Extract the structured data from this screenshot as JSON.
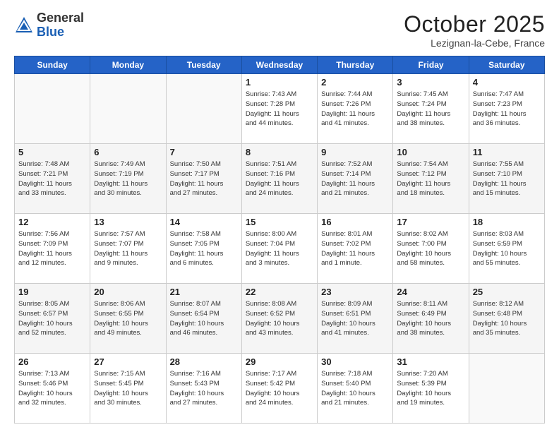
{
  "logo": {
    "general": "General",
    "blue": "Blue"
  },
  "header": {
    "month": "October 2025",
    "location": "Lezignan-la-Cebe, France"
  },
  "days_of_week": [
    "Sunday",
    "Monday",
    "Tuesday",
    "Wednesday",
    "Thursday",
    "Friday",
    "Saturday"
  ],
  "weeks": [
    [
      {
        "day": "",
        "info": ""
      },
      {
        "day": "",
        "info": ""
      },
      {
        "day": "",
        "info": ""
      },
      {
        "day": "1",
        "info": "Sunrise: 7:43 AM\nSunset: 7:28 PM\nDaylight: 11 hours\nand 44 minutes."
      },
      {
        "day": "2",
        "info": "Sunrise: 7:44 AM\nSunset: 7:26 PM\nDaylight: 11 hours\nand 41 minutes."
      },
      {
        "day": "3",
        "info": "Sunrise: 7:45 AM\nSunset: 7:24 PM\nDaylight: 11 hours\nand 38 minutes."
      },
      {
        "day": "4",
        "info": "Sunrise: 7:47 AM\nSunset: 7:23 PM\nDaylight: 11 hours\nand 36 minutes."
      }
    ],
    [
      {
        "day": "5",
        "info": "Sunrise: 7:48 AM\nSunset: 7:21 PM\nDaylight: 11 hours\nand 33 minutes."
      },
      {
        "day": "6",
        "info": "Sunrise: 7:49 AM\nSunset: 7:19 PM\nDaylight: 11 hours\nand 30 minutes."
      },
      {
        "day": "7",
        "info": "Sunrise: 7:50 AM\nSunset: 7:17 PM\nDaylight: 11 hours\nand 27 minutes."
      },
      {
        "day": "8",
        "info": "Sunrise: 7:51 AM\nSunset: 7:16 PM\nDaylight: 11 hours\nand 24 minutes."
      },
      {
        "day": "9",
        "info": "Sunrise: 7:52 AM\nSunset: 7:14 PM\nDaylight: 11 hours\nand 21 minutes."
      },
      {
        "day": "10",
        "info": "Sunrise: 7:54 AM\nSunset: 7:12 PM\nDaylight: 11 hours\nand 18 minutes."
      },
      {
        "day": "11",
        "info": "Sunrise: 7:55 AM\nSunset: 7:10 PM\nDaylight: 11 hours\nand 15 minutes."
      }
    ],
    [
      {
        "day": "12",
        "info": "Sunrise: 7:56 AM\nSunset: 7:09 PM\nDaylight: 11 hours\nand 12 minutes."
      },
      {
        "day": "13",
        "info": "Sunrise: 7:57 AM\nSunset: 7:07 PM\nDaylight: 11 hours\nand 9 minutes."
      },
      {
        "day": "14",
        "info": "Sunrise: 7:58 AM\nSunset: 7:05 PM\nDaylight: 11 hours\nand 6 minutes."
      },
      {
        "day": "15",
        "info": "Sunrise: 8:00 AM\nSunset: 7:04 PM\nDaylight: 11 hours\nand 3 minutes."
      },
      {
        "day": "16",
        "info": "Sunrise: 8:01 AM\nSunset: 7:02 PM\nDaylight: 11 hours\nand 1 minute."
      },
      {
        "day": "17",
        "info": "Sunrise: 8:02 AM\nSunset: 7:00 PM\nDaylight: 10 hours\nand 58 minutes."
      },
      {
        "day": "18",
        "info": "Sunrise: 8:03 AM\nSunset: 6:59 PM\nDaylight: 10 hours\nand 55 minutes."
      }
    ],
    [
      {
        "day": "19",
        "info": "Sunrise: 8:05 AM\nSunset: 6:57 PM\nDaylight: 10 hours\nand 52 minutes."
      },
      {
        "day": "20",
        "info": "Sunrise: 8:06 AM\nSunset: 6:55 PM\nDaylight: 10 hours\nand 49 minutes."
      },
      {
        "day": "21",
        "info": "Sunrise: 8:07 AM\nSunset: 6:54 PM\nDaylight: 10 hours\nand 46 minutes."
      },
      {
        "day": "22",
        "info": "Sunrise: 8:08 AM\nSunset: 6:52 PM\nDaylight: 10 hours\nand 43 minutes."
      },
      {
        "day": "23",
        "info": "Sunrise: 8:09 AM\nSunset: 6:51 PM\nDaylight: 10 hours\nand 41 minutes."
      },
      {
        "day": "24",
        "info": "Sunrise: 8:11 AM\nSunset: 6:49 PM\nDaylight: 10 hours\nand 38 minutes."
      },
      {
        "day": "25",
        "info": "Sunrise: 8:12 AM\nSunset: 6:48 PM\nDaylight: 10 hours\nand 35 minutes."
      }
    ],
    [
      {
        "day": "26",
        "info": "Sunrise: 7:13 AM\nSunset: 5:46 PM\nDaylight: 10 hours\nand 32 minutes."
      },
      {
        "day": "27",
        "info": "Sunrise: 7:15 AM\nSunset: 5:45 PM\nDaylight: 10 hours\nand 30 minutes."
      },
      {
        "day": "28",
        "info": "Sunrise: 7:16 AM\nSunset: 5:43 PM\nDaylight: 10 hours\nand 27 minutes."
      },
      {
        "day": "29",
        "info": "Sunrise: 7:17 AM\nSunset: 5:42 PM\nDaylight: 10 hours\nand 24 minutes."
      },
      {
        "day": "30",
        "info": "Sunrise: 7:18 AM\nSunset: 5:40 PM\nDaylight: 10 hours\nand 21 minutes."
      },
      {
        "day": "31",
        "info": "Sunrise: 7:20 AM\nSunset: 5:39 PM\nDaylight: 10 hours\nand 19 minutes."
      },
      {
        "day": "",
        "info": ""
      }
    ]
  ]
}
